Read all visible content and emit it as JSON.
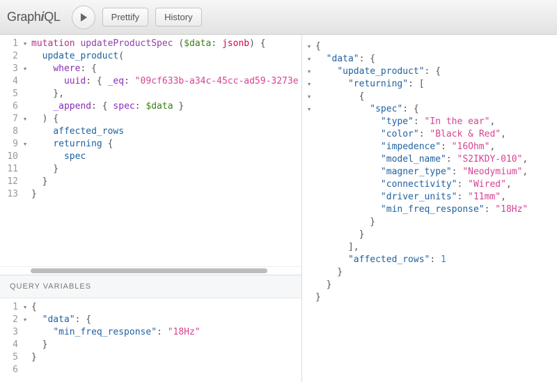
{
  "header": {
    "logo_prefix": "Graph",
    "logo_em": "i",
    "logo_suffix": "QL",
    "prettify_label": "Prettify",
    "history_label": "History",
    "play_icon": "play-icon"
  },
  "query_variables_label": "Query Variables",
  "query_lines": [
    {
      "n": "1",
      "fold": "▾",
      "segments": [
        {
          "cls": "kw-mut",
          "t": "mutation"
        },
        {
          "cls": "punc",
          "t": " "
        },
        {
          "cls": "kw-op",
          "t": "updateProductSpec"
        },
        {
          "cls": "punc",
          "t": " ("
        },
        {
          "cls": "varname",
          "t": "$data"
        },
        {
          "cls": "punc",
          "t": ": "
        },
        {
          "cls": "atom",
          "t": "jsonb"
        },
        {
          "cls": "punc",
          "t": ") {"
        }
      ]
    },
    {
      "n": "2",
      "fold": "",
      "segments": [
        {
          "cls": "punc",
          "t": "  "
        },
        {
          "cls": "prop",
          "t": "update_product"
        },
        {
          "cls": "punc",
          "t": "("
        }
      ]
    },
    {
      "n": "3",
      "fold": "▾",
      "segments": [
        {
          "cls": "punc",
          "t": "    "
        },
        {
          "cls": "attr",
          "t": "where"
        },
        {
          "cls": "punc",
          "t": ": {"
        }
      ]
    },
    {
      "n": "4",
      "fold": "",
      "segments": [
        {
          "cls": "punc",
          "t": "      "
        },
        {
          "cls": "attr",
          "t": "uuid"
        },
        {
          "cls": "punc",
          "t": ": { "
        },
        {
          "cls": "attr",
          "t": "_eq"
        },
        {
          "cls": "punc",
          "t": ": "
        },
        {
          "cls": "str",
          "t": "\"09cf633b-a34c-45cc-ad59-3273e"
        }
      ]
    },
    {
      "n": "5",
      "fold": "",
      "segments": [
        {
          "cls": "punc",
          "t": "    },"
        }
      ]
    },
    {
      "n": "6",
      "fold": "",
      "segments": [
        {
          "cls": "punc",
          "t": "    "
        },
        {
          "cls": "attr",
          "t": "_append"
        },
        {
          "cls": "punc",
          "t": ": { "
        },
        {
          "cls": "attr",
          "t": "spec"
        },
        {
          "cls": "punc",
          "t": ": "
        },
        {
          "cls": "varname",
          "t": "$data"
        },
        {
          "cls": "punc",
          "t": " }"
        }
      ]
    },
    {
      "n": "7",
      "fold": "▾",
      "segments": [
        {
          "cls": "punc",
          "t": "  ) {"
        }
      ]
    },
    {
      "n": "8",
      "fold": "",
      "segments": [
        {
          "cls": "punc",
          "t": "    "
        },
        {
          "cls": "prop",
          "t": "affected_rows"
        }
      ]
    },
    {
      "n": "9",
      "fold": "▾",
      "segments": [
        {
          "cls": "punc",
          "t": "    "
        },
        {
          "cls": "prop",
          "t": "returning"
        },
        {
          "cls": "punc",
          "t": " {"
        }
      ]
    },
    {
      "n": "10",
      "fold": "",
      "segments": [
        {
          "cls": "punc",
          "t": "      "
        },
        {
          "cls": "prop",
          "t": "spec"
        }
      ]
    },
    {
      "n": "11",
      "fold": "",
      "segments": [
        {
          "cls": "punc",
          "t": "    }"
        }
      ]
    },
    {
      "n": "12",
      "fold": "",
      "segments": [
        {
          "cls": "punc",
          "t": "  }"
        }
      ]
    },
    {
      "n": "13",
      "fold": "",
      "segments": [
        {
          "cls": "punc",
          "t": "}"
        }
      ]
    }
  ],
  "var_lines": [
    {
      "n": "1",
      "fold": "▾",
      "segments": [
        {
          "cls": "punc",
          "t": "{"
        }
      ]
    },
    {
      "n": "2",
      "fold": "▾",
      "segments": [
        {
          "cls": "punc",
          "t": "  "
        },
        {
          "cls": "prop",
          "t": "\"data\""
        },
        {
          "cls": "punc",
          "t": ": {"
        }
      ]
    },
    {
      "n": "3",
      "fold": "",
      "segments": [
        {
          "cls": "punc",
          "t": "    "
        },
        {
          "cls": "prop",
          "t": "\"min_freq_response\""
        },
        {
          "cls": "punc",
          "t": ": "
        },
        {
          "cls": "str",
          "t": "\"18Hz\""
        }
      ]
    },
    {
      "n": "4",
      "fold": "",
      "segments": [
        {
          "cls": "punc",
          "t": "  }"
        }
      ]
    },
    {
      "n": "5",
      "fold": "",
      "segments": [
        {
          "cls": "punc",
          "t": "}"
        }
      ]
    },
    {
      "n": "6",
      "fold": "",
      "segments": []
    }
  ],
  "result_lines": [
    {
      "fold": "▾",
      "segments": [
        {
          "cls": "punc",
          "t": "{"
        }
      ]
    },
    {
      "fold": "▾",
      "segments": [
        {
          "cls": "punc",
          "t": "  "
        },
        {
          "cls": "prop",
          "t": "\"data\""
        },
        {
          "cls": "punc",
          "t": ": {"
        }
      ]
    },
    {
      "fold": "▾",
      "segments": [
        {
          "cls": "punc",
          "t": "    "
        },
        {
          "cls": "prop",
          "t": "\"update_product\""
        },
        {
          "cls": "punc",
          "t": ": {"
        }
      ]
    },
    {
      "fold": "▾",
      "segments": [
        {
          "cls": "punc",
          "t": "      "
        },
        {
          "cls": "prop",
          "t": "\"returning\""
        },
        {
          "cls": "punc",
          "t": ": ["
        }
      ]
    },
    {
      "fold": "▾",
      "segments": [
        {
          "cls": "punc",
          "t": "        {"
        }
      ]
    },
    {
      "fold": "▾",
      "segments": [
        {
          "cls": "punc",
          "t": "          "
        },
        {
          "cls": "prop",
          "t": "\"spec\""
        },
        {
          "cls": "punc",
          "t": ": {"
        }
      ]
    },
    {
      "fold": "",
      "segments": [
        {
          "cls": "punc",
          "t": "            "
        },
        {
          "cls": "prop",
          "t": "\"type\""
        },
        {
          "cls": "punc",
          "t": ": "
        },
        {
          "cls": "str",
          "t": "\"In the ear\""
        },
        {
          "cls": "punc",
          "t": ","
        }
      ]
    },
    {
      "fold": "",
      "segments": [
        {
          "cls": "punc",
          "t": "            "
        },
        {
          "cls": "prop",
          "t": "\"color\""
        },
        {
          "cls": "punc",
          "t": ": "
        },
        {
          "cls": "str",
          "t": "\"Black & Red\""
        },
        {
          "cls": "punc",
          "t": ","
        }
      ]
    },
    {
      "fold": "",
      "segments": [
        {
          "cls": "punc",
          "t": "            "
        },
        {
          "cls": "prop",
          "t": "\"impedence\""
        },
        {
          "cls": "punc",
          "t": ": "
        },
        {
          "cls": "str",
          "t": "\"16Ohm\""
        },
        {
          "cls": "punc",
          "t": ","
        }
      ]
    },
    {
      "fold": "",
      "segments": [
        {
          "cls": "punc",
          "t": "            "
        },
        {
          "cls": "prop",
          "t": "\"model_name\""
        },
        {
          "cls": "punc",
          "t": ": "
        },
        {
          "cls": "str",
          "t": "\"S2IKDY-010\""
        },
        {
          "cls": "punc",
          "t": ","
        }
      ]
    },
    {
      "fold": "",
      "segments": [
        {
          "cls": "punc",
          "t": "            "
        },
        {
          "cls": "prop",
          "t": "\"magner_type\""
        },
        {
          "cls": "punc",
          "t": ": "
        },
        {
          "cls": "str",
          "t": "\"Neodymium\""
        },
        {
          "cls": "punc",
          "t": ","
        }
      ]
    },
    {
      "fold": "",
      "segments": [
        {
          "cls": "punc",
          "t": "            "
        },
        {
          "cls": "prop",
          "t": "\"connectivity\""
        },
        {
          "cls": "punc",
          "t": ": "
        },
        {
          "cls": "str",
          "t": "\"Wired\""
        },
        {
          "cls": "punc",
          "t": ","
        }
      ]
    },
    {
      "fold": "",
      "segments": [
        {
          "cls": "punc",
          "t": "            "
        },
        {
          "cls": "prop",
          "t": "\"driver_units\""
        },
        {
          "cls": "punc",
          "t": ": "
        },
        {
          "cls": "str",
          "t": "\"11mm\""
        },
        {
          "cls": "punc",
          "t": ","
        }
      ]
    },
    {
      "fold": "",
      "segments": [
        {
          "cls": "punc",
          "t": "            "
        },
        {
          "cls": "prop",
          "t": "\"min_freq_response\""
        },
        {
          "cls": "punc",
          "t": ": "
        },
        {
          "cls": "str",
          "t": "\"18Hz\""
        }
      ]
    },
    {
      "fold": "",
      "segments": [
        {
          "cls": "punc",
          "t": "          }"
        }
      ]
    },
    {
      "fold": "",
      "segments": [
        {
          "cls": "punc",
          "t": "        }"
        }
      ]
    },
    {
      "fold": "",
      "segments": [
        {
          "cls": "punc",
          "t": "      ],"
        }
      ]
    },
    {
      "fold": "",
      "segments": [
        {
          "cls": "punc",
          "t": "      "
        },
        {
          "cls": "prop",
          "t": "\"affected_rows\""
        },
        {
          "cls": "punc",
          "t": ": "
        },
        {
          "cls": "num",
          "t": "1"
        }
      ]
    },
    {
      "fold": "",
      "segments": [
        {
          "cls": "punc",
          "t": "    }"
        }
      ]
    },
    {
      "fold": "",
      "segments": [
        {
          "cls": "punc",
          "t": "  }"
        }
      ]
    },
    {
      "fold": "",
      "segments": [
        {
          "cls": "punc",
          "t": "}"
        }
      ]
    }
  ]
}
